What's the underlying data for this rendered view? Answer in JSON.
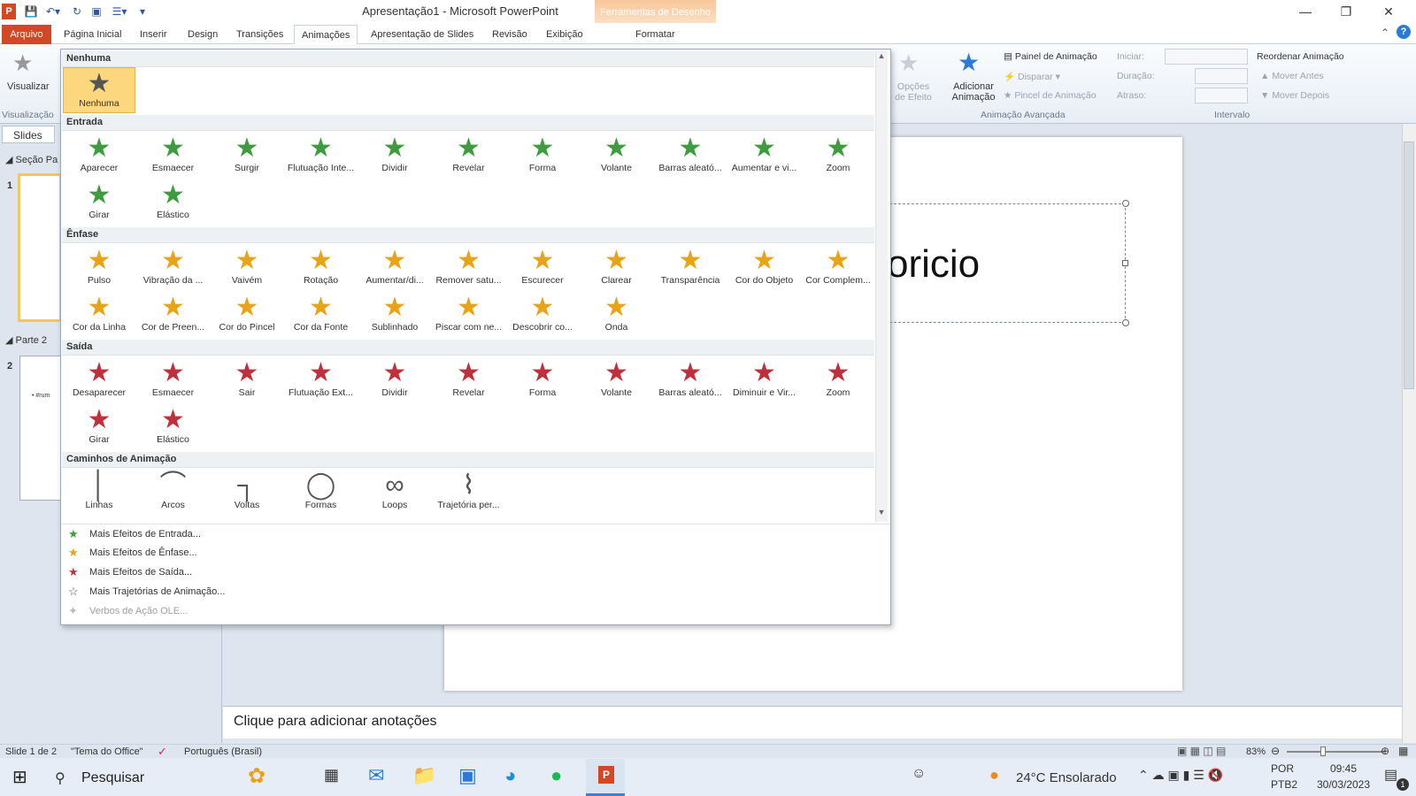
{
  "window": {
    "title": "Apresentação1 - Microsoft PowerPoint",
    "context_tab_title": "Ferramentas de Desenho"
  },
  "tabs": [
    "Arquivo",
    "Página Inicial",
    "Inserir",
    "Design",
    "Transições",
    "Animações",
    "Apresentação de Slides",
    "Revisão",
    "Exibição",
    "Formatar"
  ],
  "ribbon": {
    "preview_label": "Visualizar",
    "preview_group": "Visualização",
    "effect_options": "Opções de Efeito",
    "add_animation": "Adicionar Animação",
    "animation_pane": "Painel de Animação",
    "trigger": "Disparar",
    "animation_painter": "Pincel de Animação",
    "advanced_group": "Animação Avançada",
    "start_label": "Iniciar:",
    "duration_label": "Duração:",
    "delay_label": "Atraso:",
    "timing_group": "Intervalo",
    "reorder": "Reordenar Animação",
    "move_earlier": "Mover Antes",
    "move_later": "Mover Depois"
  },
  "left_panel": {
    "tab_slides": "Slides",
    "section1": "Seção Pa",
    "section2": "Parte 2",
    "slide1_num": "1",
    "slide2_num": "2",
    "slide2_text": "• #rum"
  },
  "gallery": {
    "none_header": "Nenhuma",
    "none_item": "Nenhuma",
    "entrance_header": "Entrada",
    "entrance": [
      "Aparecer",
      "Esmaecer",
      "Surgir",
      "Flutuação Inte...",
      "Dividir",
      "Revelar",
      "Forma",
      "Volante",
      "Barras aleató...",
      "Aumentar e vi...",
      "Zoom",
      "Girar",
      "Elástico"
    ],
    "emphasis_header": "Ênfase",
    "emphasis": [
      "Pulso",
      "Vibração da ...",
      "Vaivém",
      "Rotação",
      "Aumentar/di...",
      "Remover satu...",
      "Escurecer",
      "Clarear",
      "Transparência",
      "Cor do Objeto",
      "Cor Complem...",
      "Cor da Linha",
      "Cor de Preen...",
      "Cor do Pincel",
      "Cor da Fonte",
      "Sublinhado",
      "Piscar com ne...",
      "Descobrir co...",
      "Onda"
    ],
    "exit_header": "Saída",
    "exit": [
      "Desaparecer",
      "Esmaecer",
      "Sair",
      "Flutuação Ext...",
      "Dividir",
      "Revelar",
      "Forma",
      "Volante",
      "Barras aleató...",
      "Diminuir e Vir...",
      "Zoom",
      "Girar",
      "Elástico"
    ],
    "paths_header": "Caminhos de Animação",
    "paths": [
      "Linhas",
      "Arcos",
      "Voltas",
      "Formas",
      "Loops",
      "Trajetória per..."
    ],
    "menu": [
      "Mais Efeitos de Entrada...",
      "Mais Efeitos de Ênfase...",
      "Mais Efeitos de Saída...",
      "Mais Trajetórias de Animação...",
      "Verbos de Ação OLE..."
    ]
  },
  "slide": {
    "title_fragment": "oricio"
  },
  "notes_placeholder": "Clique para adicionar anotações",
  "status": {
    "slide": "Slide 1 de 2",
    "theme": "\"Tema do Office\"",
    "language": "Português (Brasil)",
    "zoom": "83%"
  },
  "taskbar": {
    "search": "Pesquisar",
    "weather": "24°C  Ensolarado",
    "lang1": "POR",
    "lang2": "PTB2",
    "time": "09:45",
    "date": "30/03/2023",
    "notif": "1"
  }
}
